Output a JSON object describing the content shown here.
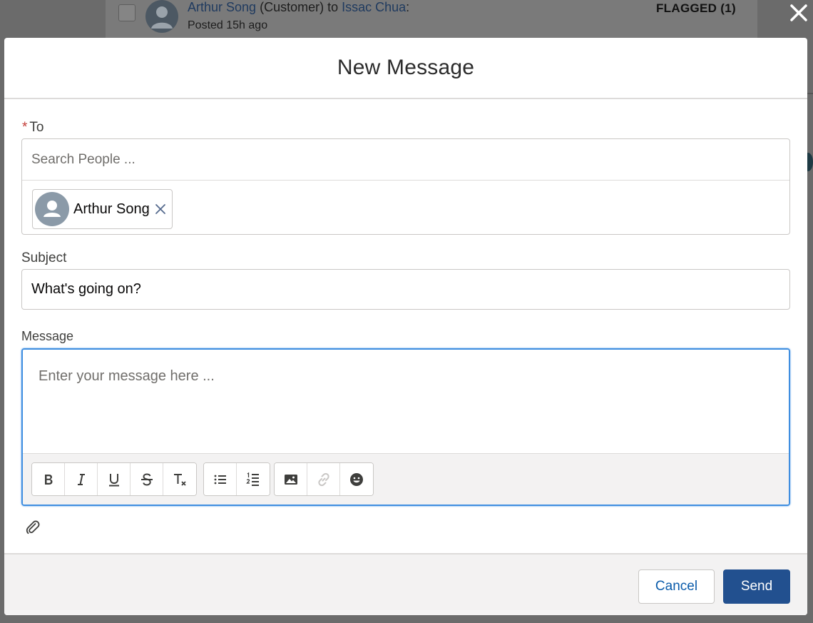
{
  "background": {
    "feed_author": "Arthur Song",
    "feed_role": "(Customer) to",
    "feed_recipient": "Issac Chua",
    "feed_colon": ":",
    "feed_posted": "Posted 15h ago",
    "flagged_label": "FLAGGED (1)"
  },
  "modal": {
    "title": "New Message",
    "to": {
      "required_mark": "*",
      "label": "To",
      "search_placeholder": "Search People ...",
      "recipients": [
        {
          "name": "Arthur Song"
        }
      ]
    },
    "subject": {
      "label": "Subject",
      "value": "What's going on?"
    },
    "message": {
      "label": "Message",
      "placeholder": "Enter your message here ..."
    },
    "toolbar": {
      "groups": [
        [
          "bold-icon",
          "italic-icon",
          "underline-icon",
          "strikethrough-icon",
          "clear-format-icon"
        ],
        [
          "bullet-list-icon",
          "numbered-list-icon"
        ],
        [
          "image-icon",
          "link-icon",
          "emoji-icon"
        ]
      ]
    },
    "footer": {
      "cancel_label": "Cancel",
      "send_label": "Send"
    }
  },
  "colors": {
    "send_button": "#22508f",
    "focus_border": "#3f8ee0",
    "required": "#c23934",
    "link_text": "#0b5cab"
  }
}
